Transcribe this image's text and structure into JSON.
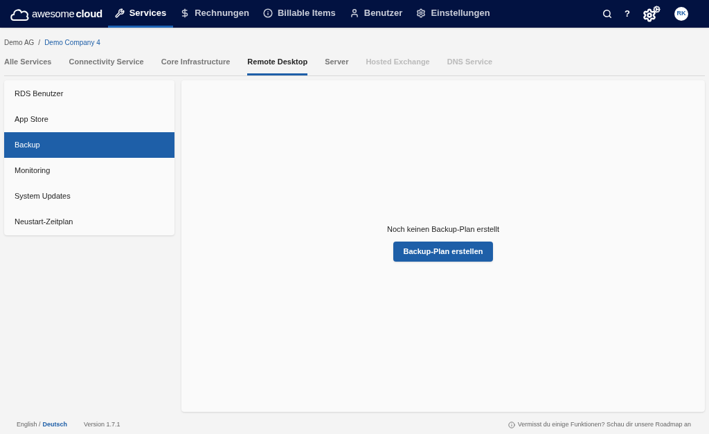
{
  "logo": {
    "light": "awesome",
    "bold": "cloud"
  },
  "nav": [
    {
      "label": "Services",
      "selected": true
    },
    {
      "label": "Rechnungen",
      "selected": false
    },
    {
      "label": "Billable Items",
      "selected": false
    },
    {
      "label": "Benutzer",
      "selected": false
    },
    {
      "label": "Einstellungen",
      "selected": false
    }
  ],
  "header_actions": {
    "help": "?",
    "avatar": "RK"
  },
  "breadcrumb": {
    "root": "Demo AG",
    "separator": "/",
    "current": "Demo Company 4"
  },
  "tabs": [
    {
      "label": "Alle Services",
      "selected": false,
      "disabled": false
    },
    {
      "label": "Connectivity Service",
      "selected": false,
      "disabled": false
    },
    {
      "label": "Core Infrastructure",
      "selected": false,
      "disabled": false
    },
    {
      "label": "Remote Desktop",
      "selected": true,
      "disabled": false
    },
    {
      "label": "Server",
      "selected": false,
      "disabled": false
    },
    {
      "label": "Hosted Exchange",
      "selected": false,
      "disabled": true
    },
    {
      "label": "DNS Service",
      "selected": false,
      "disabled": true
    }
  ],
  "sidebar": {
    "items": [
      {
        "label": "RDS Benutzer",
        "selected": false
      },
      {
        "label": "App Store",
        "selected": false
      },
      {
        "label": "Backup",
        "selected": true
      },
      {
        "label": "Monitoring",
        "selected": false
      },
      {
        "label": "System Updates",
        "selected": false
      },
      {
        "label": "Neustart-Zeitplan",
        "selected": false
      }
    ]
  },
  "empty_state": {
    "message": "Noch keinen Backup-Plan erstellt",
    "button": "Backup-Plan erstellen"
  },
  "footer": {
    "lang_en": "English /",
    "lang_de": "Deutsch",
    "version": "Version 1.7.1",
    "hint": "Vermisst du einige Funktionen? Schau dir unsere Roadmap an"
  }
}
